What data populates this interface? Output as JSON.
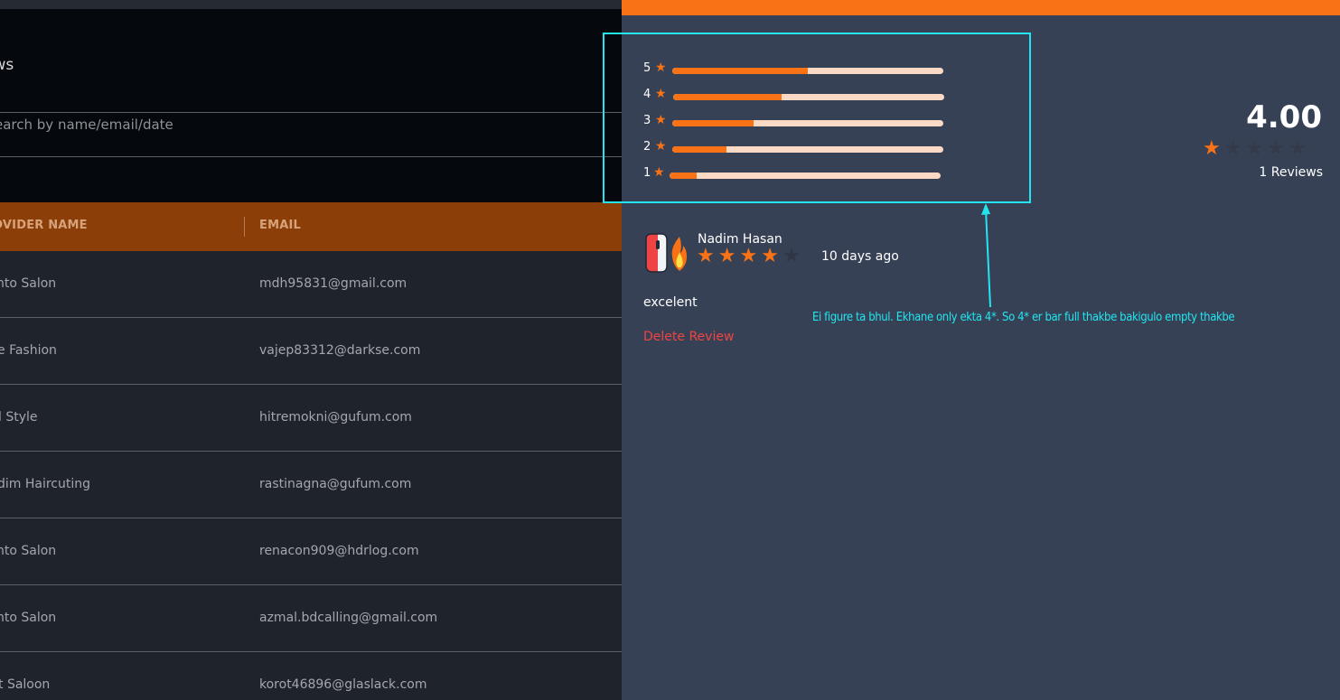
{
  "reviews_page": {
    "title": "ews",
    "search_placeholder": "earch by name/email/date",
    "table": {
      "columns": [
        "OVIDER NAME",
        "EMAIL"
      ],
      "rows": [
        {
          "provider": "nto Salon",
          "email": "mdh95831@gmail.com"
        },
        {
          "provider": "e Fashion",
          "email": "vajep83312@darkse.com"
        },
        {
          "provider": "l Style",
          "email": "hitremokni@gufum.com"
        },
        {
          "provider": "dim Haircuting",
          "email": "rastinagna@gufum.com"
        },
        {
          "provider": "nto Salon",
          "email": "renacon909@hdrlog.com"
        },
        {
          "provider": "nto Salon",
          "email": "azmal.bdcalling@gmail.com"
        },
        {
          "provider": "t Saloon",
          "email": "korot46896@glaslack.com"
        }
      ]
    }
  },
  "rating_summary": {
    "average": "4.00",
    "average_stars": 1,
    "reviews_count": "1 Reviews",
    "breakdown": [
      {
        "stars": "5",
        "fill_fraction": 0.5
      },
      {
        "stars": "4",
        "fill_fraction": 0.4
      },
      {
        "stars": "3",
        "fill_fraction": 0.3
      },
      {
        "stars": "2",
        "fill_fraction": 0.2
      },
      {
        "stars": "1",
        "fill_fraction": 0.1
      }
    ]
  },
  "review": {
    "name": "Nadim Hasan",
    "rating": 4,
    "time": "10 days ago",
    "text": "excelent",
    "delete_label": "Delete Review"
  },
  "annotation": "Ei figure ta bhul. Ekhane only ekta 4*. So 4* er bar full thakbe bakigulo empty thakbe",
  "colors": {
    "accent": "#f97316",
    "annotation": "#22e5f0",
    "delete": "#ef4444"
  }
}
